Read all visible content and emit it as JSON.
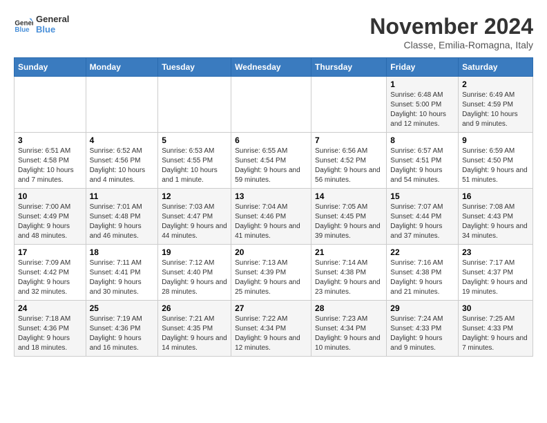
{
  "logo": {
    "line1": "General",
    "line2": "Blue"
  },
  "title": "November 2024",
  "subtitle": "Classe, Emilia-Romagna, Italy",
  "weekdays": [
    "Sunday",
    "Monday",
    "Tuesday",
    "Wednesday",
    "Thursday",
    "Friday",
    "Saturday"
  ],
  "weeks": [
    [
      {
        "day": "",
        "info": ""
      },
      {
        "day": "",
        "info": ""
      },
      {
        "day": "",
        "info": ""
      },
      {
        "day": "",
        "info": ""
      },
      {
        "day": "",
        "info": ""
      },
      {
        "day": "1",
        "info": "Sunrise: 6:48 AM\nSunset: 5:00 PM\nDaylight: 10 hours and 12 minutes."
      },
      {
        "day": "2",
        "info": "Sunrise: 6:49 AM\nSunset: 4:59 PM\nDaylight: 10 hours and 9 minutes."
      }
    ],
    [
      {
        "day": "3",
        "info": "Sunrise: 6:51 AM\nSunset: 4:58 PM\nDaylight: 10 hours and 7 minutes."
      },
      {
        "day": "4",
        "info": "Sunrise: 6:52 AM\nSunset: 4:56 PM\nDaylight: 10 hours and 4 minutes."
      },
      {
        "day": "5",
        "info": "Sunrise: 6:53 AM\nSunset: 4:55 PM\nDaylight: 10 hours and 1 minute."
      },
      {
        "day": "6",
        "info": "Sunrise: 6:55 AM\nSunset: 4:54 PM\nDaylight: 9 hours and 59 minutes."
      },
      {
        "day": "7",
        "info": "Sunrise: 6:56 AM\nSunset: 4:52 PM\nDaylight: 9 hours and 56 minutes."
      },
      {
        "day": "8",
        "info": "Sunrise: 6:57 AM\nSunset: 4:51 PM\nDaylight: 9 hours and 54 minutes."
      },
      {
        "day": "9",
        "info": "Sunrise: 6:59 AM\nSunset: 4:50 PM\nDaylight: 9 hours and 51 minutes."
      }
    ],
    [
      {
        "day": "10",
        "info": "Sunrise: 7:00 AM\nSunset: 4:49 PM\nDaylight: 9 hours and 48 minutes."
      },
      {
        "day": "11",
        "info": "Sunrise: 7:01 AM\nSunset: 4:48 PM\nDaylight: 9 hours and 46 minutes."
      },
      {
        "day": "12",
        "info": "Sunrise: 7:03 AM\nSunset: 4:47 PM\nDaylight: 9 hours and 44 minutes."
      },
      {
        "day": "13",
        "info": "Sunrise: 7:04 AM\nSunset: 4:46 PM\nDaylight: 9 hours and 41 minutes."
      },
      {
        "day": "14",
        "info": "Sunrise: 7:05 AM\nSunset: 4:45 PM\nDaylight: 9 hours and 39 minutes."
      },
      {
        "day": "15",
        "info": "Sunrise: 7:07 AM\nSunset: 4:44 PM\nDaylight: 9 hours and 37 minutes."
      },
      {
        "day": "16",
        "info": "Sunrise: 7:08 AM\nSunset: 4:43 PM\nDaylight: 9 hours and 34 minutes."
      }
    ],
    [
      {
        "day": "17",
        "info": "Sunrise: 7:09 AM\nSunset: 4:42 PM\nDaylight: 9 hours and 32 minutes."
      },
      {
        "day": "18",
        "info": "Sunrise: 7:11 AM\nSunset: 4:41 PM\nDaylight: 9 hours and 30 minutes."
      },
      {
        "day": "19",
        "info": "Sunrise: 7:12 AM\nSunset: 4:40 PM\nDaylight: 9 hours and 28 minutes."
      },
      {
        "day": "20",
        "info": "Sunrise: 7:13 AM\nSunset: 4:39 PM\nDaylight: 9 hours and 25 minutes."
      },
      {
        "day": "21",
        "info": "Sunrise: 7:14 AM\nSunset: 4:38 PM\nDaylight: 9 hours and 23 minutes."
      },
      {
        "day": "22",
        "info": "Sunrise: 7:16 AM\nSunset: 4:38 PM\nDaylight: 9 hours and 21 minutes."
      },
      {
        "day": "23",
        "info": "Sunrise: 7:17 AM\nSunset: 4:37 PM\nDaylight: 9 hours and 19 minutes."
      }
    ],
    [
      {
        "day": "24",
        "info": "Sunrise: 7:18 AM\nSunset: 4:36 PM\nDaylight: 9 hours and 18 minutes."
      },
      {
        "day": "25",
        "info": "Sunrise: 7:19 AM\nSunset: 4:36 PM\nDaylight: 9 hours and 16 minutes."
      },
      {
        "day": "26",
        "info": "Sunrise: 7:21 AM\nSunset: 4:35 PM\nDaylight: 9 hours and 14 minutes."
      },
      {
        "day": "27",
        "info": "Sunrise: 7:22 AM\nSunset: 4:34 PM\nDaylight: 9 hours and 12 minutes."
      },
      {
        "day": "28",
        "info": "Sunrise: 7:23 AM\nSunset: 4:34 PM\nDaylight: 9 hours and 10 minutes."
      },
      {
        "day": "29",
        "info": "Sunrise: 7:24 AM\nSunset: 4:33 PM\nDaylight: 9 hours and 9 minutes."
      },
      {
        "day": "30",
        "info": "Sunrise: 7:25 AM\nSunset: 4:33 PM\nDaylight: 9 hours and 7 minutes."
      }
    ]
  ]
}
